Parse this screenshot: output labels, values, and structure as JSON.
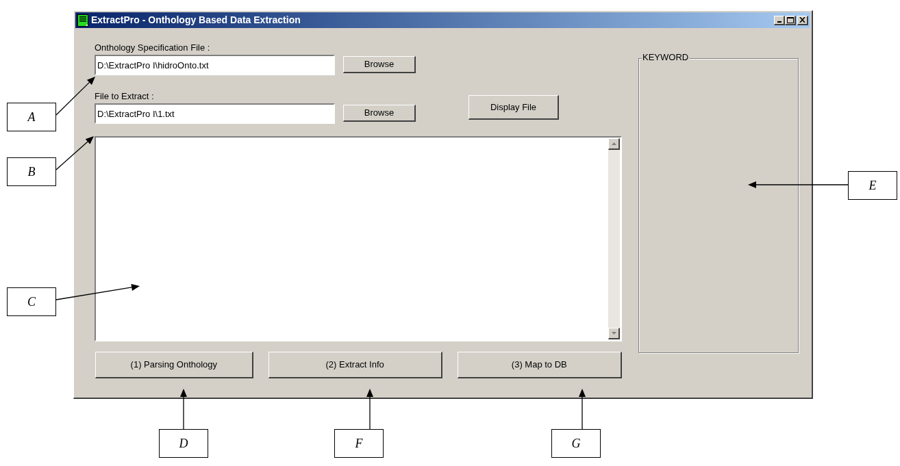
{
  "window": {
    "title": "ExtractPro - Onthology Based Data Extraction"
  },
  "ontology_file": {
    "label": "Onthology Specification File :",
    "value": "D:\\ExtractPro I\\hidroOnto.txt",
    "button": "Browse"
  },
  "extract_file": {
    "label": "File to Extract :",
    "value": "D:\\ExtractPro I\\1.txt",
    "button": "Browse"
  },
  "display_button": "Display File",
  "keyword_group": {
    "title": "KEYWORD"
  },
  "action_buttons": [
    "(1) Parsing Onthology",
    "(2) Extract Info",
    "(3) Map to DB"
  ],
  "callouts": [
    {
      "label": "A"
    },
    {
      "label": "B"
    },
    {
      "label": "C"
    },
    {
      "label": "D"
    },
    {
      "label": "F"
    },
    {
      "label": "G"
    },
    {
      "label": "E"
    }
  ]
}
